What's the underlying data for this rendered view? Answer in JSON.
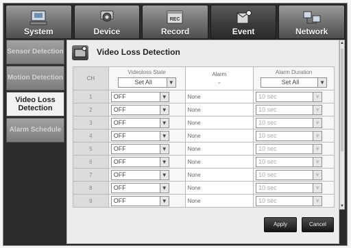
{
  "tabs": [
    {
      "label": "System",
      "icon": "monitor-icon"
    },
    {
      "label": "Device",
      "icon": "camera-icon"
    },
    {
      "label": "Record",
      "icon": "record-icon"
    },
    {
      "label": "Event",
      "icon": "event-icon",
      "active": true
    },
    {
      "label": "Network",
      "icon": "network-icon"
    }
  ],
  "side_menu": [
    {
      "label": "Sensor Detection"
    },
    {
      "label": "Motion Detection"
    },
    {
      "label": "Video Loss Detection",
      "active": true
    },
    {
      "label": "Alarm Schedule"
    }
  ],
  "panel": {
    "title": "Video Loss Detection",
    "columns": {
      "ch": "CH",
      "state": "Videoloss State",
      "alarm": "Alarm",
      "duration": "Alarm Duration"
    },
    "header_state_value": "Set All",
    "header_duration_value": "Set All",
    "rows": [
      {
        "ch": "1",
        "state": "OFF",
        "alarm": "None",
        "duration": "10 sec"
      },
      {
        "ch": "2",
        "state": "OFF",
        "alarm": "None",
        "duration": "10 sec"
      },
      {
        "ch": "3",
        "state": "OFF",
        "alarm": "None",
        "duration": "10 sec"
      },
      {
        "ch": "4",
        "state": "OFF",
        "alarm": "None",
        "duration": "10 sec"
      },
      {
        "ch": "5",
        "state": "OFF",
        "alarm": "None",
        "duration": "10 sec"
      },
      {
        "ch": "6",
        "state": "OFF",
        "alarm": "None",
        "duration": "10 sec"
      },
      {
        "ch": "7",
        "state": "OFF",
        "alarm": "None",
        "duration": "10 sec"
      },
      {
        "ch": "8",
        "state": "OFF",
        "alarm": "None",
        "duration": "10 sec"
      },
      {
        "ch": "9",
        "state": "OFF",
        "alarm": "None",
        "duration": "10 sec"
      }
    ],
    "apply": "Apply",
    "cancel": "Cancel"
  }
}
